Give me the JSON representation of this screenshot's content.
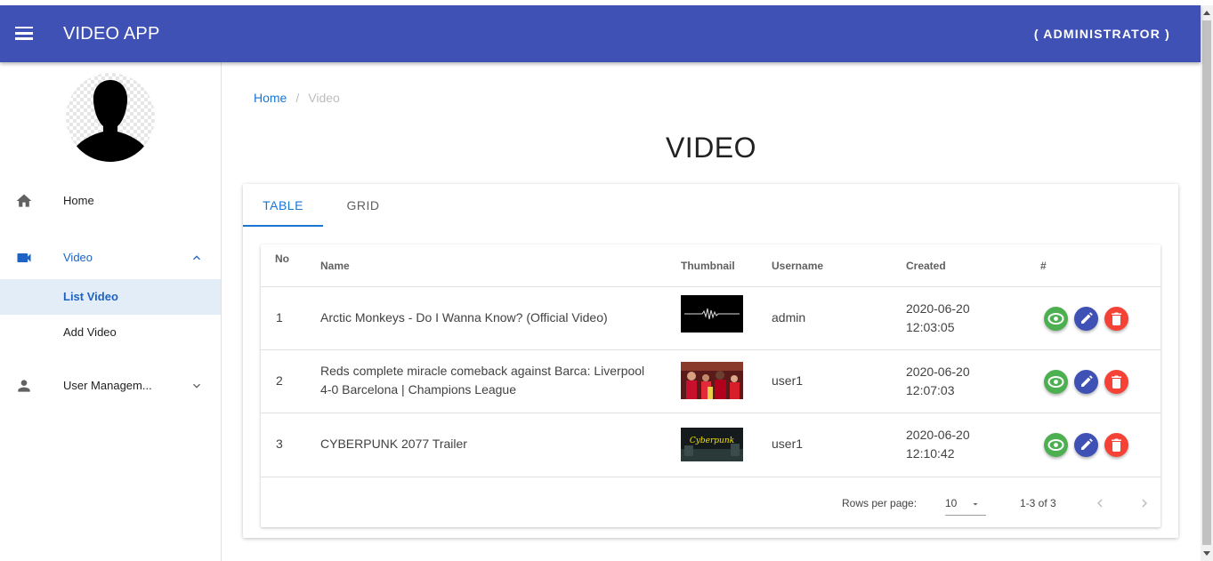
{
  "app": {
    "title": "VIDEO APP",
    "user_role": "( ADMINISTRATOR )"
  },
  "colors": {
    "primary": "#3f51b5",
    "accent": "#1976d2",
    "view": "#4caf50",
    "edit": "#3f51b5",
    "delete": "#f44336"
  },
  "sidebar": {
    "avatar_icon": "person-silhouette-icon",
    "items": [
      {
        "label": "Home",
        "icon": "home-icon"
      },
      {
        "label": "Video",
        "icon": "videocam-icon",
        "expanded": true,
        "children": [
          {
            "label": "List Video",
            "selected": true
          },
          {
            "label": "Add Video"
          }
        ]
      },
      {
        "label": "User Managem...",
        "icon": "person-icon",
        "expanded": false
      }
    ]
  },
  "breadcrumb": {
    "home": "Home",
    "current": "Video"
  },
  "page": {
    "title": "VIDEO"
  },
  "tabs": [
    {
      "label": "TABLE",
      "active": true
    },
    {
      "label": "GRID",
      "active": false
    }
  ],
  "table": {
    "columns": {
      "no": "No",
      "name": "Name",
      "thumbnail": "Thumbnail",
      "username": "Username",
      "created": "Created",
      "actions": "#"
    },
    "rows": [
      {
        "no": "1",
        "name": "Arctic Monkeys - Do I Wanna Know? (Official Video)",
        "username": "admin",
        "created_date": "2020-06-20",
        "created_time": "12:03:05"
      },
      {
        "no": "2",
        "name_line1": "Reds complete miracle comeback against Barca: Liverpool",
        "name_line2": "4-0 Barcelona | Champions League",
        "username": "user1",
        "created_date": "2020-06-20",
        "created_time": "12:07:03"
      },
      {
        "no": "3",
        "name": "CYBERPUNK 2077 Trailer",
        "username": "user1",
        "created_date": "2020-06-20",
        "created_time": "12:10:42"
      }
    ],
    "thumbnail_text_row3": "Cyberpunk"
  },
  "pagination": {
    "rows_per_page_label": "Rows per page:",
    "rows_per_page": "10",
    "range": "1-3 of 3"
  }
}
